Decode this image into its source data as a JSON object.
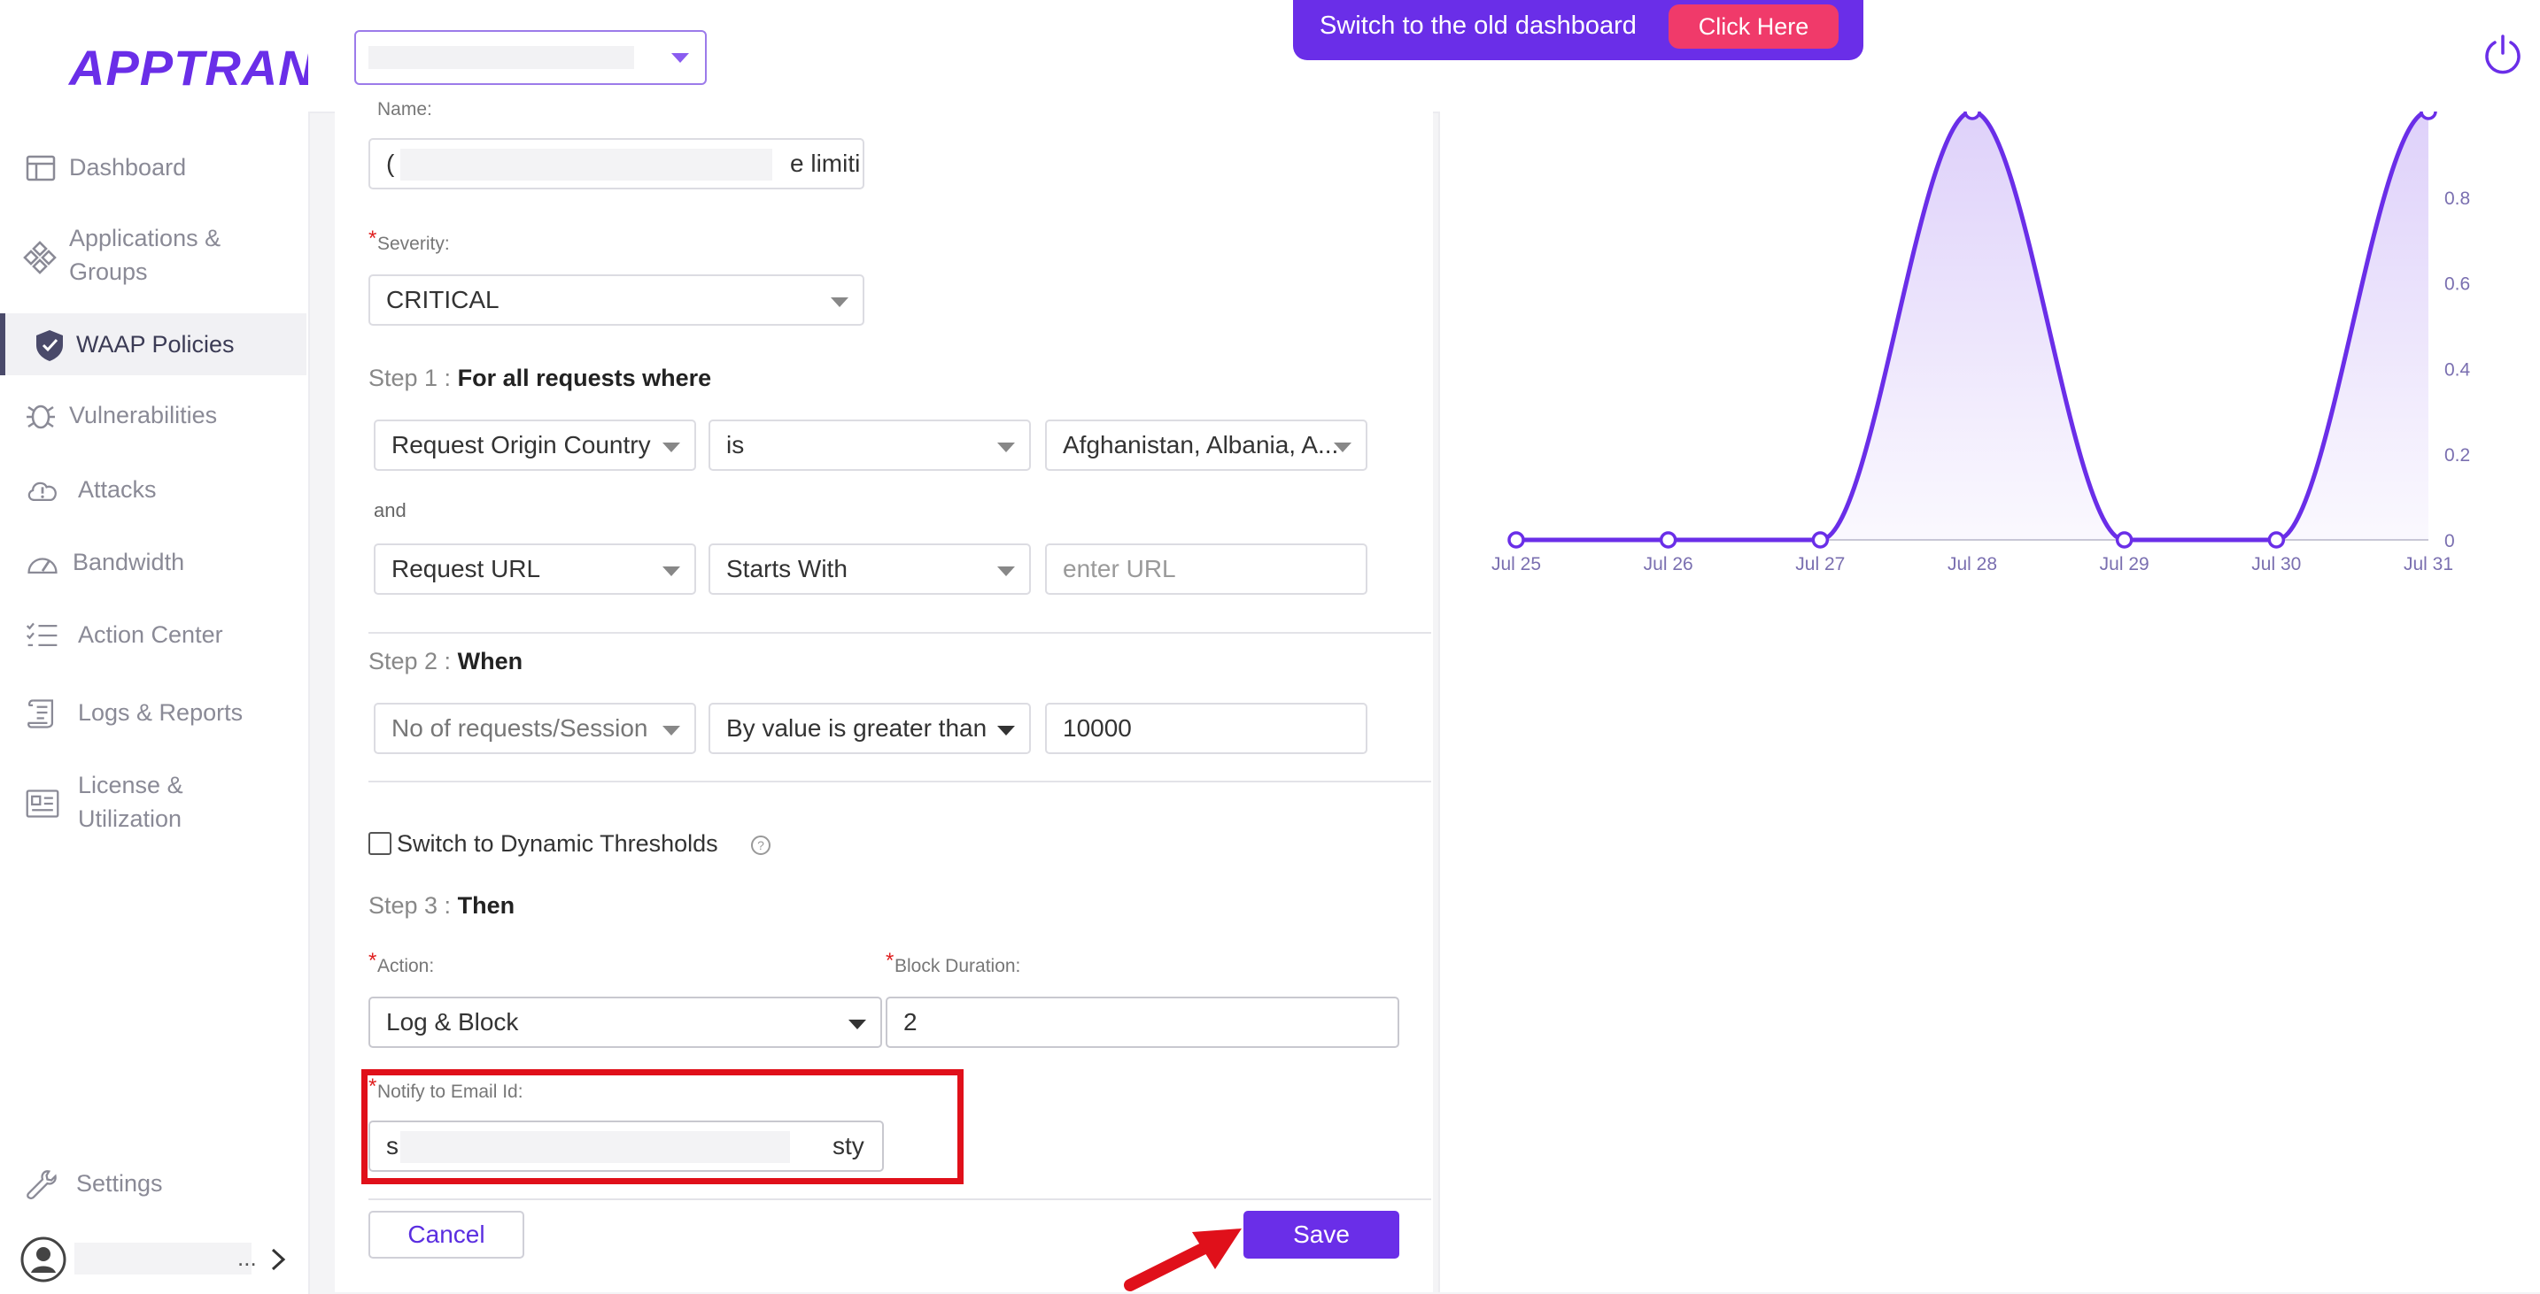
{
  "brand": {
    "logo": "APPTRANA",
    "accent": "#6a2ee8"
  },
  "sidebar": {
    "items": [
      {
        "label": "Dashboard",
        "icon": "layout-icon"
      },
      {
        "label": "Applications & Groups",
        "line1": "Applications &",
        "line2": "Groups",
        "icon": "diamond-grid-icon"
      },
      {
        "label": "WAAP Policies",
        "icon": "shield-icon",
        "active": true
      },
      {
        "label": "Vulnerabilities",
        "icon": "bug-icon"
      },
      {
        "label": "Attacks",
        "icon": "alert-cloud-icon"
      },
      {
        "label": "Bandwidth",
        "icon": "gauge-icon"
      },
      {
        "label": "Action Center",
        "icon": "checklist-icon"
      },
      {
        "label": "Logs & Reports",
        "icon": "scroll-icon"
      },
      {
        "label": "License & Utilization",
        "line1": "License &",
        "line2": "Utilization",
        "icon": "license-icon"
      },
      {
        "label": "Settings",
        "icon": "wrench-icon"
      }
    ],
    "user": {
      "name_suffix": "..."
    }
  },
  "topbar": {
    "banner_text": "Switch to the old dashboard",
    "banner_button": "Click Here"
  },
  "form": {
    "name_label": "Name:",
    "name_value_start": "(",
    "name_value_end": "e limiti",
    "severity_label": "Severity:",
    "severity_value": "CRITICAL",
    "step1_prefix": "Step 1 :",
    "step1_title": "For all requests where",
    "cond1": {
      "field": "Request Origin Country",
      "operator": "is",
      "value": "Afghanistan, Albania, A..."
    },
    "joiner": "and",
    "cond2": {
      "field": "Request URL",
      "operator": "Starts With",
      "placeholder": "enter URL"
    },
    "step2_prefix": "Step 2 :",
    "step2_title": "When",
    "when": {
      "field": "No of requests/Session",
      "operator": "By value is greater than",
      "value": "10000"
    },
    "dynamic_label": "Switch to Dynamic Thresholds",
    "step3_prefix": "Step 3 :",
    "step3_title": "Then",
    "action_label": "Action:",
    "action_value": "Log & Block",
    "block_duration_label": "Block Duration:",
    "block_duration_value": "2",
    "email_label": "Notify to Email Id:",
    "email_value_start": "s",
    "email_value_end": "sty",
    "cancel": "Cancel",
    "save": "Save",
    "required_mark": "*"
  },
  "chart_data": {
    "type": "area",
    "x": [
      "Jul 25",
      "Jul 26",
      "Jul 27",
      "Jul 28",
      "Jul 29",
      "Jul 30",
      "Jul 31"
    ],
    "series": [
      {
        "values": [
          0,
          0,
          0,
          1,
          0,
          0,
          1
        ]
      }
    ],
    "y_ticks": [
      "0",
      "0.2",
      "0.4",
      "0.6",
      "0.8"
    ],
    "ylim": [
      0,
      1
    ],
    "color": "#6a2ee8"
  },
  "annotation": {
    "highlight_color": "#e0101a",
    "arrow_color": "#e0101a"
  }
}
